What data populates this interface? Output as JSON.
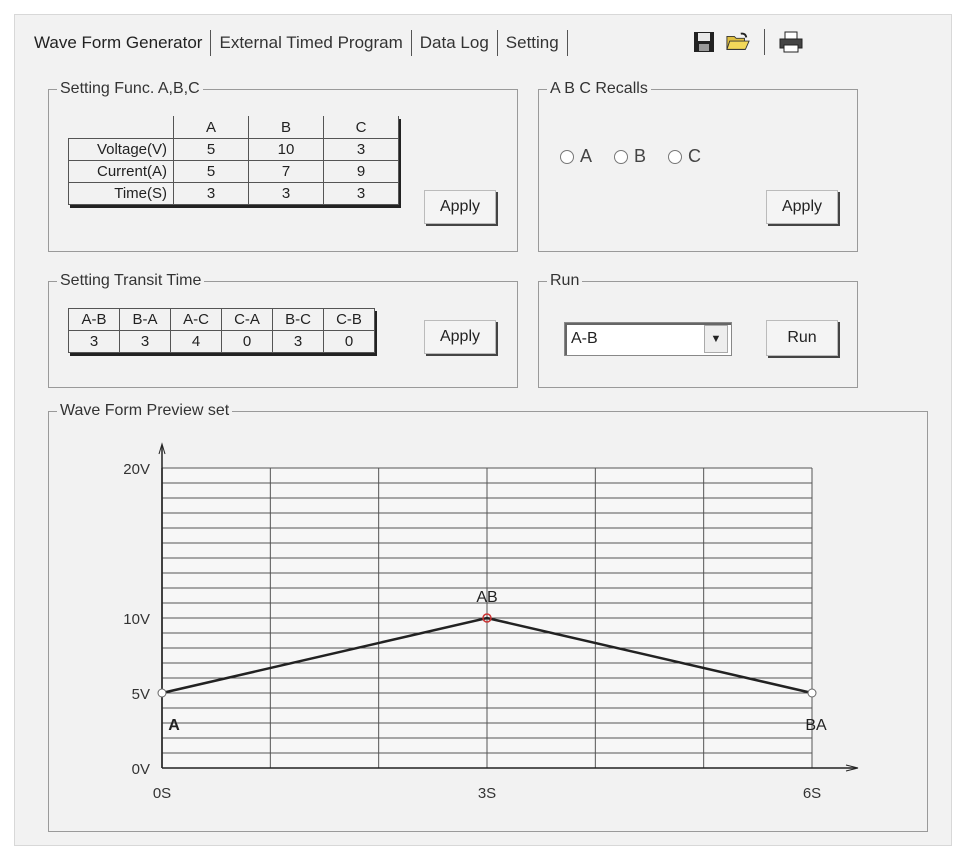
{
  "tabs": [
    {
      "label": "Wave Form Generator",
      "active": true
    },
    {
      "label": "External Timed Program",
      "active": false
    },
    {
      "label": "Data Log",
      "active": false
    },
    {
      "label": "Setting",
      "active": false
    }
  ],
  "toolbar": {
    "icons": [
      "save-icon",
      "open-folder-icon",
      "print-icon"
    ]
  },
  "setting_func": {
    "title": "Setting Func. A,B,C",
    "columns": [
      "A",
      "B",
      "C"
    ],
    "rows": [
      {
        "label": "Voltage(V)",
        "values": [
          "5",
          "10",
          "3"
        ]
      },
      {
        "label": "Current(A)",
        "values": [
          "5",
          "7",
          "9"
        ]
      },
      {
        "label": "Time(S)",
        "values": [
          "3",
          "3",
          "3"
        ]
      }
    ],
    "apply_label": "Apply"
  },
  "recalls": {
    "title": "A B C Recalls",
    "options": [
      "A",
      "B",
      "C"
    ],
    "apply_label": "Apply"
  },
  "transit": {
    "title": "Setting Transit Time",
    "headers": [
      "A-B",
      "B-A",
      "A-C",
      "C-A",
      "B-C",
      "C-B"
    ],
    "values": [
      "3",
      "3",
      "4",
      "0",
      "3",
      "0"
    ],
    "apply_label": "Apply"
  },
  "run": {
    "title": "Run",
    "selected": "A-B",
    "run_label": "Run"
  },
  "preview": {
    "title": "Wave Form Preview set"
  },
  "chart_data": {
    "type": "line",
    "title": "",
    "xlabel": "",
    "ylabel": "",
    "x_ticks": [
      "0S",
      "3S",
      "6S"
    ],
    "y_ticks": [
      "0V",
      "5V",
      "10V",
      "20V"
    ],
    "xlim": [
      0,
      6
    ],
    "ylim": [
      0,
      22
    ],
    "series": [
      {
        "values": [
          [
            0,
            5
          ],
          [
            3,
            10
          ],
          [
            6,
            5
          ]
        ]
      }
    ],
    "point_labels": [
      "A",
      "AB",
      "BA"
    ],
    "grid": true,
    "colors": {
      "line": "#222222",
      "marker": "#cc3333",
      "grid": "#555555"
    }
  }
}
